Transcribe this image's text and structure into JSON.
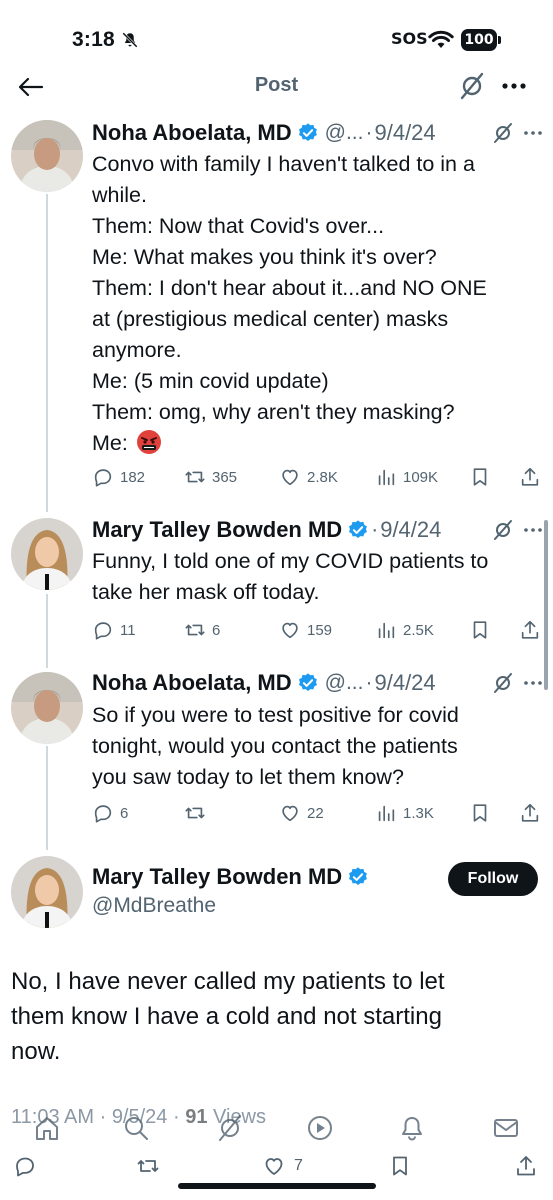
{
  "status_bar": {
    "time": "3:18",
    "sos": "SOS",
    "battery": "100"
  },
  "nav": {
    "title": "Post"
  },
  "tweets": [
    {
      "author": "Noha Aboelata, MD",
      "handle": "@...",
      "date": "9/4/24",
      "lines": [
        "Convo with family I haven't talked to in a",
        "while.",
        "Them: Now that Covid's over...",
        "Me: What makes you think it's over?",
        "Them: I don't hear about it...and NO ONE",
        "at (prestigious medical center) masks",
        "anymore.",
        "Me: (5 min covid update)",
        "Them: omg, why aren't they masking?",
        "Me:"
      ],
      "stats": {
        "replies": "182",
        "reposts": "365",
        "likes": "2.8K",
        "views": "109K"
      }
    },
    {
      "author": "Mary Talley Bowden MD",
      "handle": "",
      "date": "9/4/24",
      "lines": [
        "Funny, I told one of my COVID patients to",
        "take her mask off today."
      ],
      "stats": {
        "replies": "11",
        "reposts": "6",
        "likes": "159",
        "views": "2.5K"
      }
    },
    {
      "author": "Noha Aboelata, MD",
      "handle": "@...",
      "date": "9/4/24",
      "lines": [
        "So if you were to test positive for covid",
        "tonight, would you contact the patients",
        "you saw today to let them know?"
      ],
      "stats": {
        "replies": "6",
        "reposts": "",
        "likes": "22",
        "views": "1.3K"
      }
    }
  ],
  "main_tweet": {
    "author": "Mary Talley Bowden MD",
    "handle": "@MdBreathe",
    "follow_label": "Follow",
    "lines": [
      "No, I have never called my patients to let",
      "them know I have a cold and not starting",
      "now."
    ],
    "time": "11:03 AM",
    "date": "9/5/24",
    "views_count": "91",
    "views_label": "Views",
    "likes": "7"
  },
  "colors": {
    "verified": "#1d9bf0",
    "text": "#0f1419",
    "muted": "#536471"
  }
}
